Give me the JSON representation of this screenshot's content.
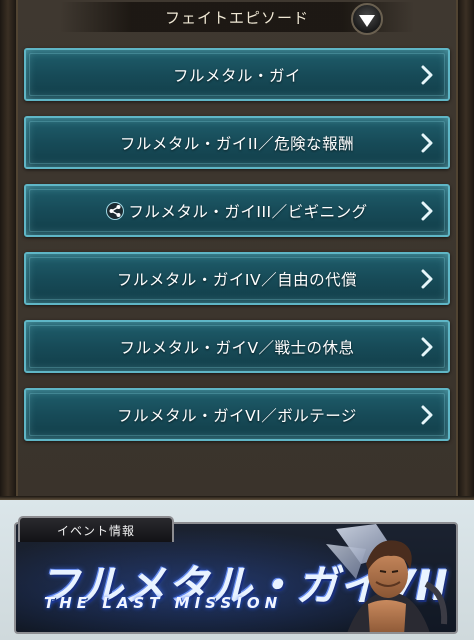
{
  "header": {
    "title": "フェイトエピソード",
    "toggle_icon": "collapse-triangle-icon"
  },
  "episodes": [
    {
      "label": "フルメタル・ガイ",
      "has_scenario_icon": false
    },
    {
      "label": "フルメタル・ガイII／危険な報酬",
      "has_scenario_icon": false
    },
    {
      "label": "フルメタル・ガイIII／ビギニング",
      "has_scenario_icon": true
    },
    {
      "label": "フルメタル・ガイIV／自由の代償",
      "has_scenario_icon": false
    },
    {
      "label": "フルメタル・ガイV／戦士の休息",
      "has_scenario_icon": false
    },
    {
      "label": "フルメタル・ガイVI／ボルテージ",
      "has_scenario_icon": false
    }
  ],
  "banner": {
    "tab_label": "イベント情報",
    "title": "フルメタル・ガイVII",
    "subtitle": "THE LAST MISSION"
  },
  "colors": {
    "button_fill": "#174b58",
    "button_border": "#5fb6c6",
    "panel_bg": "#3a332b",
    "banner_blue": "#3c6bf0"
  }
}
